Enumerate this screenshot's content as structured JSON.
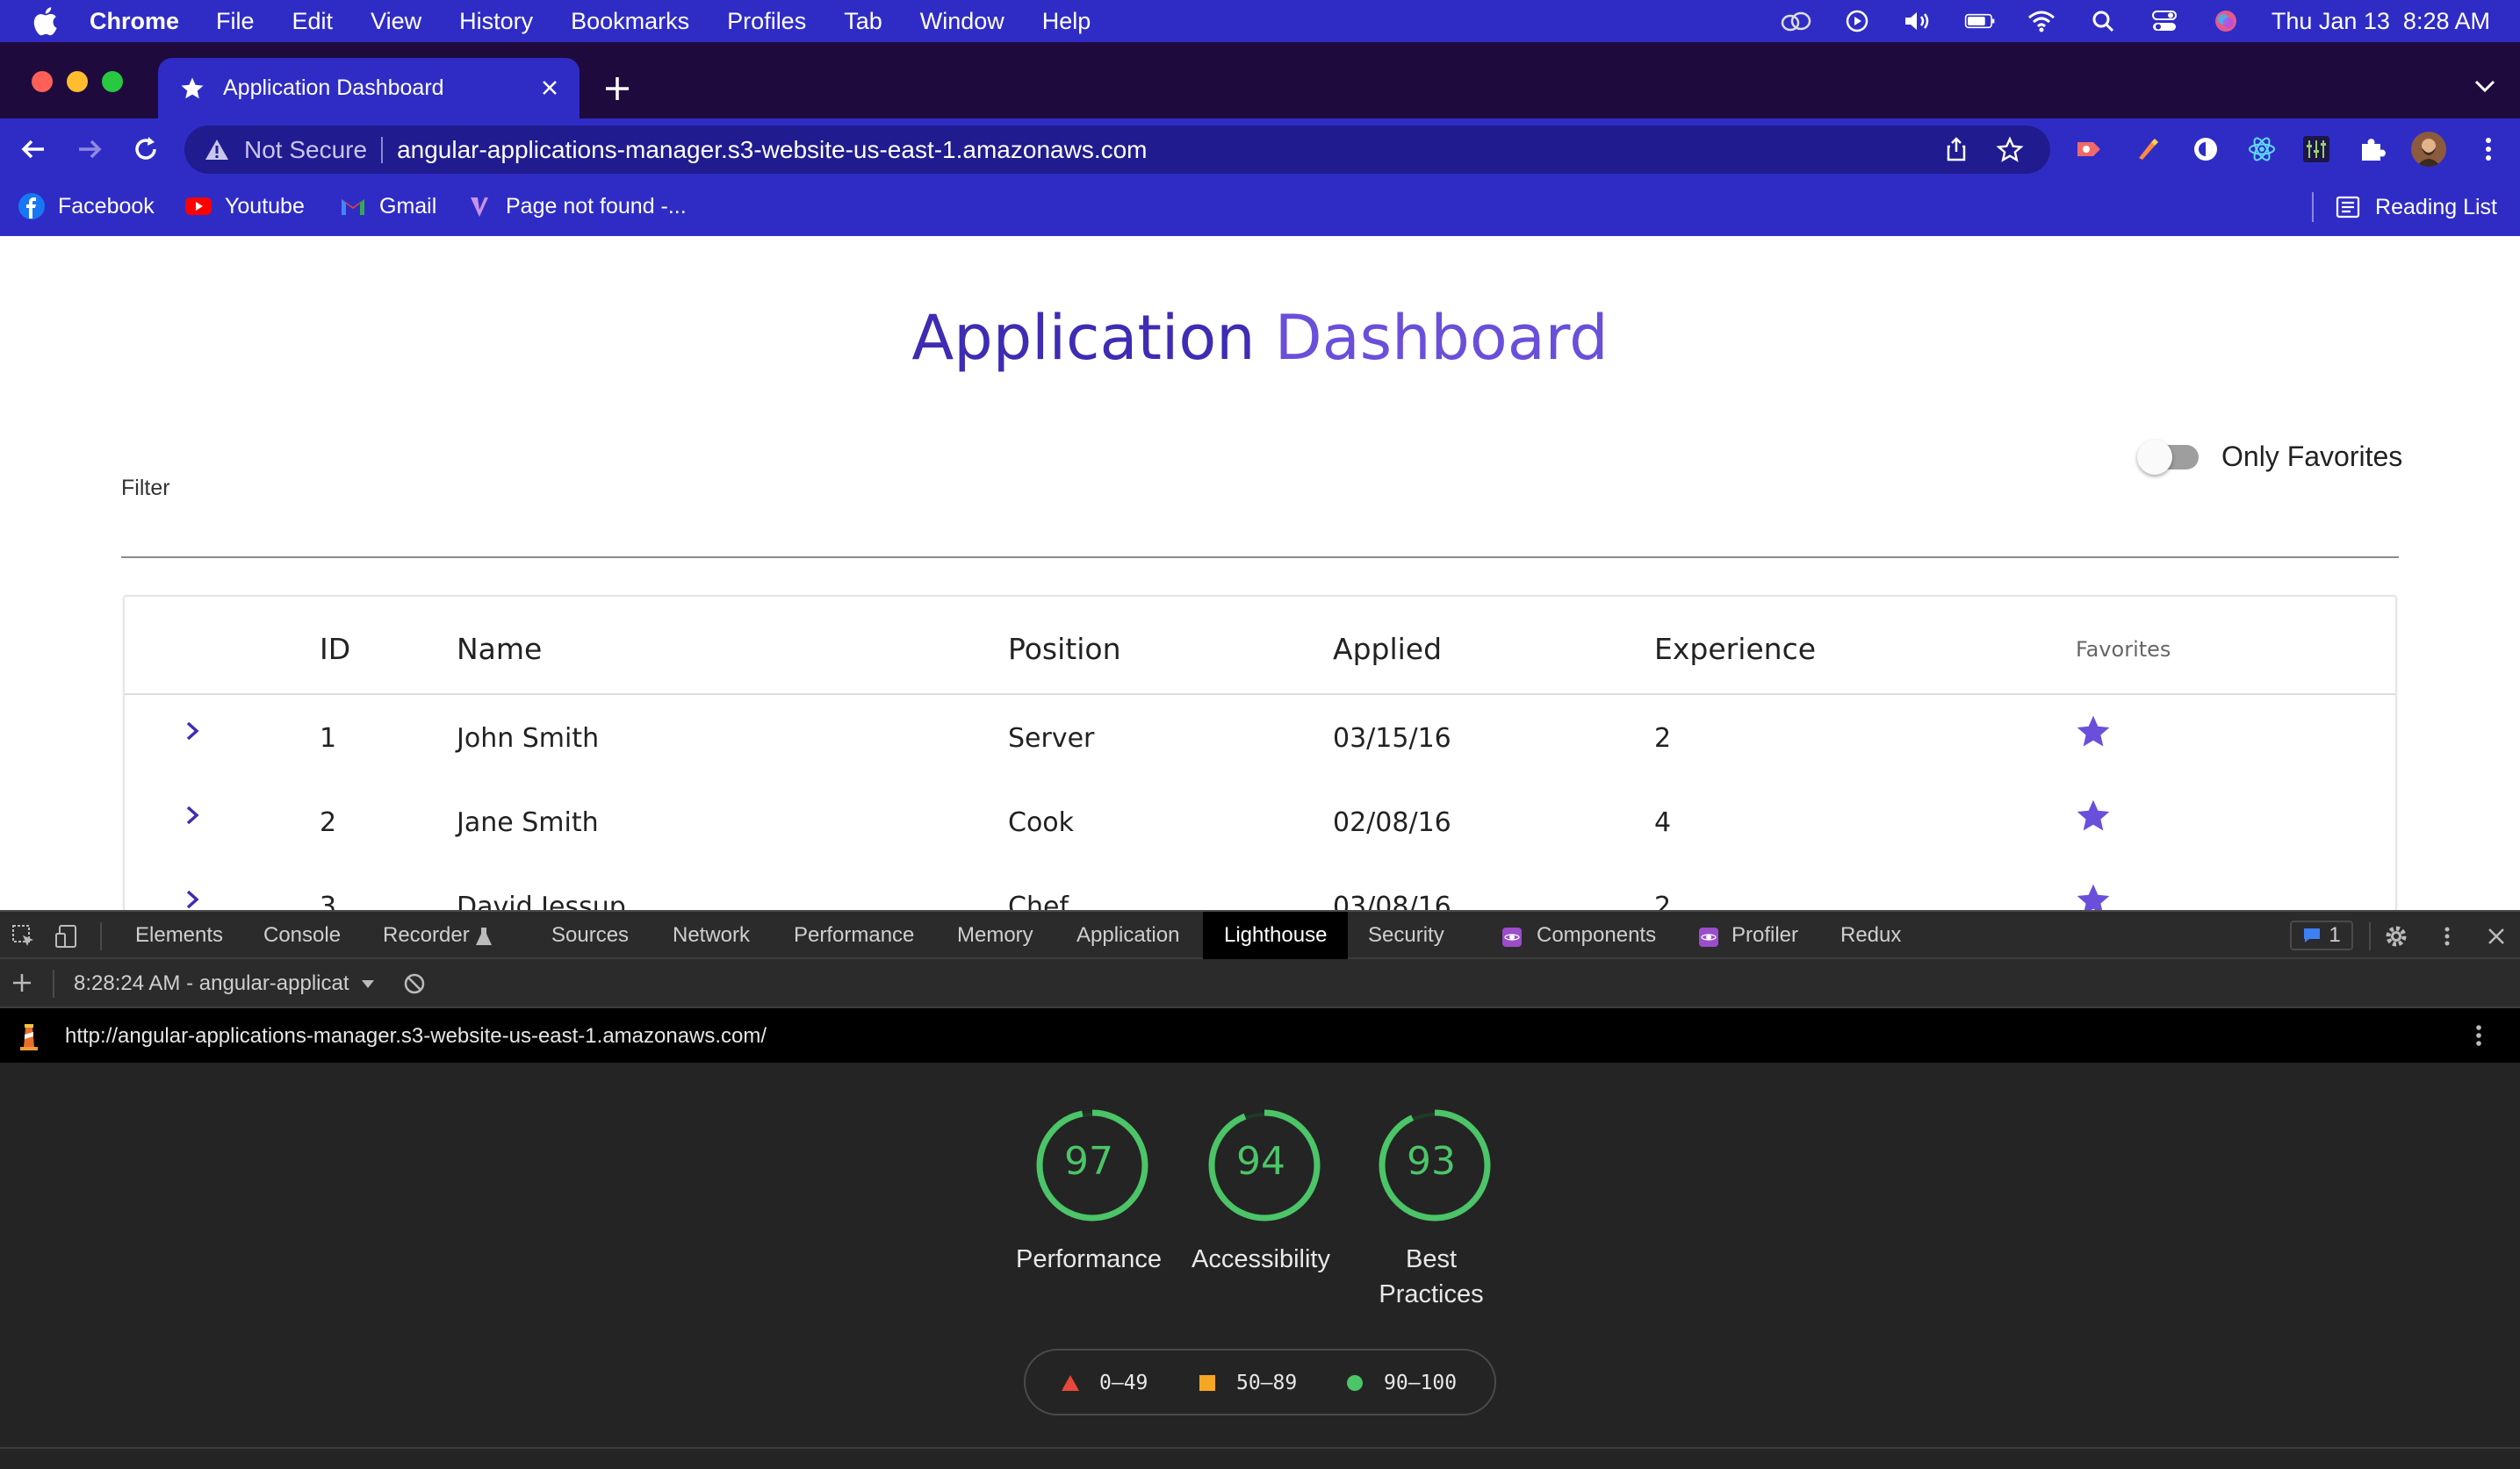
{
  "menubar": {
    "app_name": "Chrome",
    "menus": [
      "File",
      "Edit",
      "View",
      "History",
      "Bookmarks",
      "Profiles",
      "Tab",
      "Window",
      "Help"
    ],
    "datetime": "Thu Jan 13  8:28 AM"
  },
  "browser": {
    "tab_title": "Application Dashboard",
    "security_label": "Not Secure",
    "url": "angular-applications-manager.s3-website-us-east-1.amazonaws.com",
    "bookmarks": [
      "Facebook",
      "Youtube",
      "Gmail",
      "Page not found -..."
    ],
    "reading_list": "Reading List"
  },
  "page": {
    "title_part1": "Application",
    "title_part2": "Dashboard",
    "toggle_label": "Only Favorites",
    "toggle_on": false,
    "filter_label": "Filter",
    "columns": [
      "ID",
      "Name",
      "Position",
      "Applied",
      "Experience",
      "Favorites"
    ],
    "rows": [
      {
        "id": "1",
        "name": "John Smith",
        "position": "Server",
        "applied": "03/15/16",
        "experience": "2",
        "favorite": true
      },
      {
        "id": "2",
        "name": "Jane Smith",
        "position": "Cook",
        "applied": "02/08/16",
        "experience": "4",
        "favorite": true
      },
      {
        "id": "3",
        "name": "David Jessup",
        "position": "Chef",
        "applied": "03/08/16",
        "experience": "2",
        "favorite": true
      }
    ],
    "colors": {
      "title_dark": "#3e2cb4",
      "title_light": "#6a4fdb",
      "star": "#6a4fdb"
    }
  },
  "devtools": {
    "tabs": [
      "Elements",
      "Console",
      "Recorder",
      "Sources",
      "Network",
      "Performance",
      "Memory",
      "Application",
      "Lighthouse",
      "Security",
      "Components",
      "Profiler",
      "Redux"
    ],
    "active_tab": "Lighthouse",
    "issues_count": "1",
    "report_selector": "8:28:24 AM - angular-applicat",
    "report_url": "http://angular-applications-manager.s3-website-us-east-1.amazonaws.com/",
    "scores": [
      {
        "label": "Performance",
        "value": 97
      },
      {
        "label": "Accessibility",
        "value": 94
      },
      {
        "label": "Best Practices",
        "value": 93
      }
    ],
    "legend": [
      "0–49",
      "50–89",
      "90–100"
    ],
    "colors": {
      "pass": "#4cc468",
      "average": "#f5a623",
      "fail": "#e8483b"
    }
  }
}
